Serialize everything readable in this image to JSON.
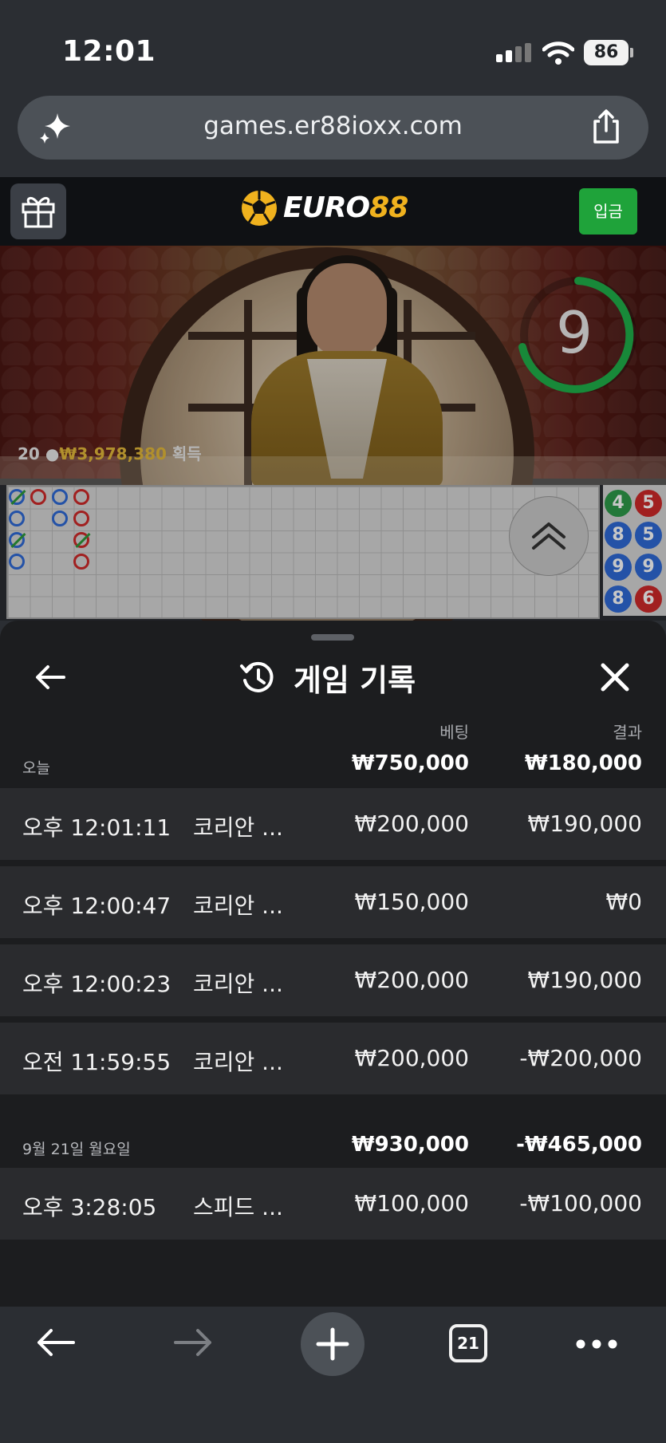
{
  "status_bar": {
    "time": "12:01",
    "battery": "86"
  },
  "browser": {
    "url": "games.er88ioxx.com",
    "tab_count": "21"
  },
  "site_header": {
    "logo_part1": "EURO",
    "logo_part2": "88",
    "deposit_label": "입금"
  },
  "live": {
    "timer_value": "9",
    "winners_count": "20",
    "winners_amount": "₩3,978,380",
    "winners_suffix": "획득",
    "right_beads": [
      "4",
      "5",
      "8",
      "5",
      "9",
      "9",
      "8",
      "6"
    ]
  },
  "history": {
    "title": "게임 기록",
    "col_bet": "베팅",
    "col_result": "결과",
    "groups": [
      {
        "date": "오늘",
        "bet_total": "₩750,000",
        "result_total": "₩180,000",
        "rows": [
          {
            "time": "오후 12:01:11",
            "game": "코리안 ...",
            "bet": "₩200,000",
            "result": "₩190,000"
          },
          {
            "time": "오후 12:00:47",
            "game": "코리안 ...",
            "bet": "₩150,000",
            "result": "₩0"
          },
          {
            "time": "오후 12:00:23",
            "game": "코리안 ...",
            "bet": "₩200,000",
            "result": "₩190,000"
          },
          {
            "time": "오전 11:59:55",
            "game": "코리안 ...",
            "bet": "₩200,000",
            "result": "-₩200,000"
          }
        ]
      },
      {
        "date": "9월 21일 월요일",
        "bet_total": "₩930,000",
        "result_total": "-₩465,000",
        "rows": [
          {
            "time": "오후 3:28:05",
            "game": "스피드 ...",
            "bet": "₩100,000",
            "result": "-₩100,000"
          }
        ]
      }
    ]
  },
  "colors": {
    "deposit_green": "#1fa33a",
    "logo_gold": "#f0b21e",
    "timer_green": "#1fb04a",
    "panel_bg": "#1c1d1f",
    "row_bg": "#2a2b2e"
  },
  "icons": [
    "sparkle-icon",
    "share-icon",
    "gift-icon",
    "soccer-ball-icon",
    "chevron-double-up-icon",
    "back-arrow-icon",
    "history-icon",
    "close-icon",
    "forward-arrow-icon",
    "plus-icon",
    "tabs-icon",
    "more-icon"
  ]
}
